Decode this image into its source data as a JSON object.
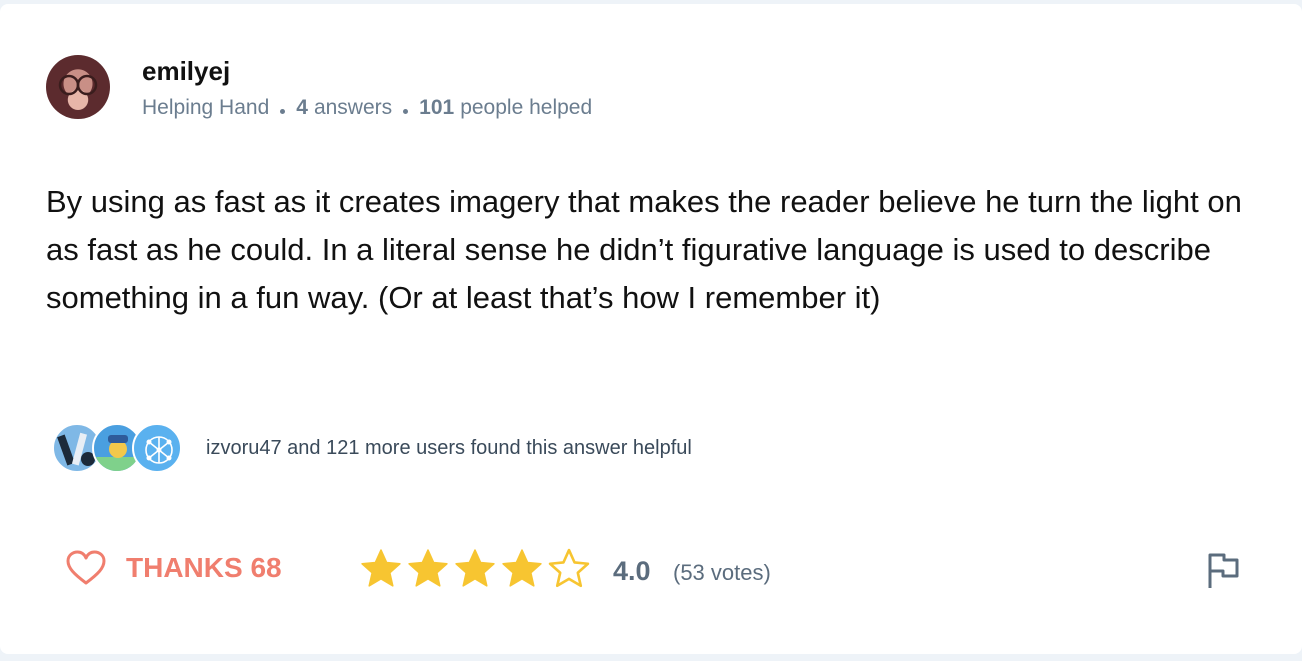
{
  "author": {
    "name": "emilyej",
    "rank": "Helping Hand",
    "answers_count": "4",
    "answers_label": "answers",
    "helped_count": "101",
    "helped_label": "people helped"
  },
  "answer": {
    "text": "By using as fast as it creates imagery that makes the reader believe he turn the light on as fast as he could. In a literal sense he didn’t figurative language is used to describe something in a fun way. (Or at least that’s how I remember it)"
  },
  "helpful": {
    "text": "izvoru47 and 121 more users found this answer helpful"
  },
  "actions": {
    "thanks_label": "THANKS 68",
    "rating_value": "4.0",
    "votes_label": "(53 votes)",
    "rating_stars": 4,
    "max_stars": 5
  },
  "colors": {
    "star": "#f7c531",
    "thanks": "#f07e6e",
    "meta": "#6b7d8f"
  }
}
